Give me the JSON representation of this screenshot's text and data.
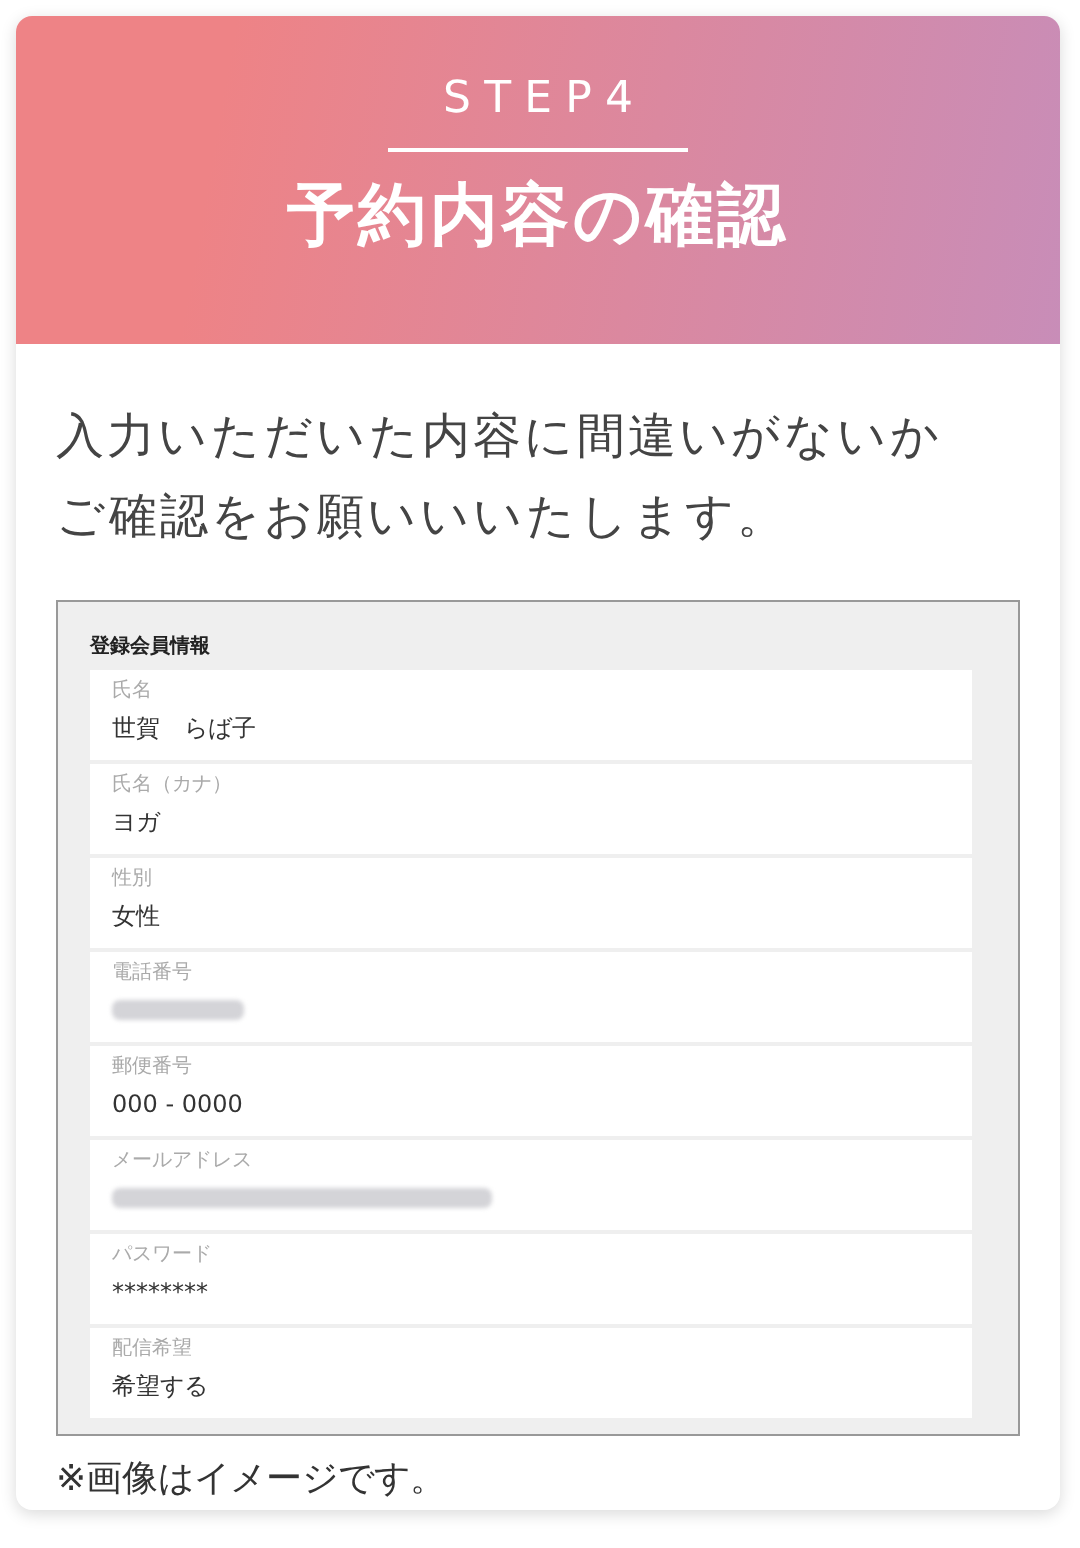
{
  "header": {
    "step": "STEP4",
    "title": "予約内容の確認"
  },
  "intro_lines": [
    "入力いただいた内容に間違いがないか",
    "ご確認をお願いいいたします。"
  ],
  "screenshot": {
    "section_title": "登録会員情報",
    "fields": [
      {
        "label": "氏名",
        "kind": "text",
        "value": "世賀　らば子"
      },
      {
        "label": "氏名（カナ）",
        "kind": "text",
        "value": "ヨガ"
      },
      {
        "label": "性別",
        "kind": "text",
        "value": "女性"
      },
      {
        "label": "電話番号",
        "kind": "blurred"
      },
      {
        "label": "郵便番号",
        "kind": "text",
        "value": "000 - 0000"
      },
      {
        "label": "メールアドレス",
        "kind": "blurred_long"
      },
      {
        "label": "パスワード",
        "kind": "text",
        "value": "********"
      },
      {
        "label": "配信希望",
        "kind": "text",
        "value": "希望する"
      }
    ]
  },
  "note": "※画像はイメージです。"
}
